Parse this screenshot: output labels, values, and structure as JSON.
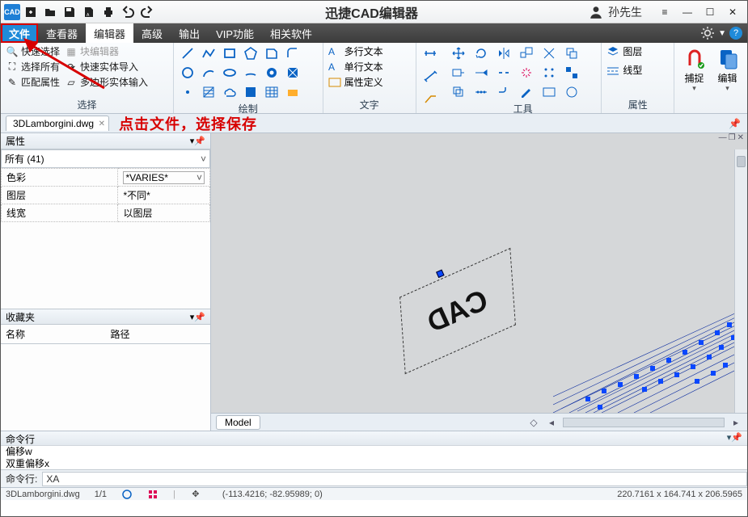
{
  "app": {
    "title": "迅捷CAD编辑器",
    "logo": "CAD"
  },
  "user": {
    "name": "孙先生"
  },
  "menus": {
    "file": "文件",
    "viewer": "查看器",
    "editor": "编辑器",
    "advanced": "高级",
    "output": "输出",
    "vip": "VIP功能",
    "related": "相关软件"
  },
  "ribbon": {
    "select": {
      "quick": "快速选择",
      "block_editor": "块编辑器",
      "select_all": "选择所有",
      "quick_import": "快速实体导入",
      "match": "匹配属性",
      "poly_entity": "多边形实体输入",
      "label": "选择"
    },
    "draw_label": "绘制",
    "textcol": {
      "multi": "多行文本",
      "single": "单行文本",
      "propdef": "属性定义",
      "label": "文字"
    },
    "tools_label": "工具",
    "props": {
      "layer": "图层",
      "ltype": "线型",
      "label": "属性"
    },
    "snap": {
      "label": "捕捉"
    },
    "edit": {
      "label": "编辑"
    }
  },
  "doc": {
    "tab": "3DLamborgini.dwg"
  },
  "annotation": "点击文件，选择保存",
  "props_pane": {
    "title": "属性",
    "filter": "所有 (41)",
    "rows": {
      "color_k": "色彩",
      "color_v": "*VARIES*",
      "layer_k": "图层",
      "layer_v": "*不同*",
      "lweight_k": "线宽",
      "lweight_v": "以图层"
    },
    "fav_title": "收藏夹",
    "fav_name": "名称",
    "fav_path": "路径"
  },
  "canvas": {
    "model_tab": "Model",
    "cad_text": "CAD"
  },
  "cmd": {
    "title": "命令行",
    "line1": "偏移w",
    "line2": "双重偏移x",
    "prompt": "命令行:",
    "input": "XA"
  },
  "status": {
    "file": "3DLamborgini.dwg",
    "page": "1/1",
    "coords": "(-113.4216; -82.95989; 0)",
    "dims": "220.7161 x 164.741 x 206.5965"
  }
}
